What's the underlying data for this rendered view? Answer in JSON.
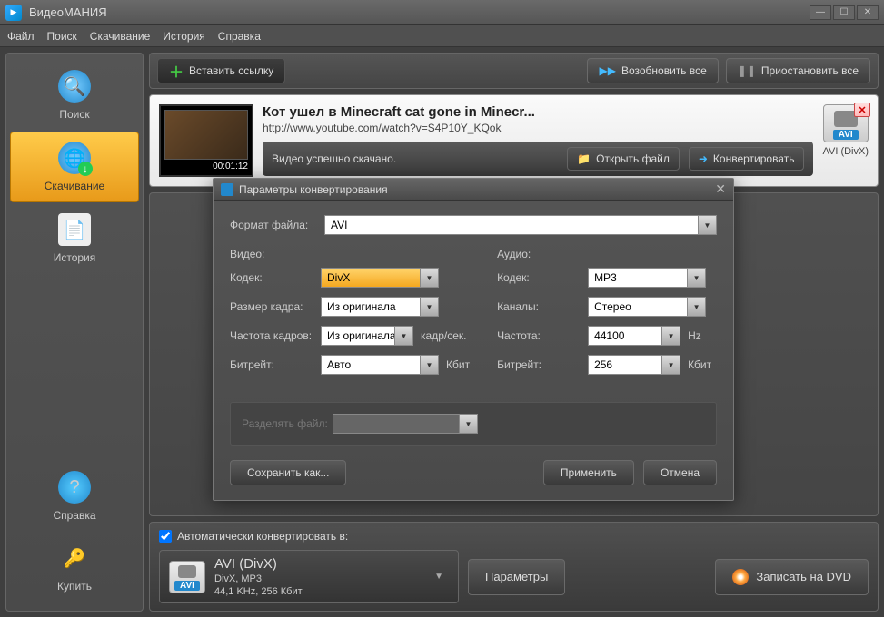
{
  "app": {
    "title": "ВидеоМАНИЯ"
  },
  "menu": {
    "file": "Файл",
    "search": "Поиск",
    "download": "Скачивание",
    "history": "История",
    "help": "Справка"
  },
  "sidebar": {
    "search": "Поиск",
    "download": "Скачивание",
    "history": "История",
    "help": "Справка",
    "buy": "Купить"
  },
  "toolbar": {
    "paste": "Вставить ссылку",
    "resume_all": "Возобновить все",
    "pause_all": "Приостановить все"
  },
  "item": {
    "title": "Кот ушел в Minecraft  cat gone in Minecr...",
    "url": "http://www.youtube.com/watch?v=S4P10Y_KQok",
    "status": "Видео успешно скачано.",
    "open": "Открыть файл",
    "convert": "Конвертировать",
    "time": "00:01:12",
    "format_short": "AVI",
    "format_caption": "AVI (DivX)"
  },
  "modal": {
    "title": "Параметры конвертирования",
    "file_format_label": "Формат файла:",
    "file_format_value": "AVI",
    "video": {
      "heading": "Видео:",
      "codec_label": "Кодек:",
      "codec_value": "DivX",
      "frame_size_label": "Размер кадра:",
      "frame_size_value": "Из оригинала",
      "fps_label": "Частота кадров:",
      "fps_value": "Из оригинала",
      "fps_unit": "кадр/сек.",
      "bitrate_label": "Битрейт:",
      "bitrate_value": "Авто",
      "bitrate_unit": "Кбит"
    },
    "audio": {
      "heading": "Аудио:",
      "codec_label": "Кодек:",
      "codec_value": "MP3",
      "channels_label": "Каналы:",
      "channels_value": "Стерео",
      "freq_label": "Частота:",
      "freq_value": "44100",
      "freq_unit": "Hz",
      "bitrate_label": "Битрейт:",
      "bitrate_value": "256",
      "bitrate_unit": "Кбит"
    },
    "split_label": "Разделять файл:",
    "save_as": "Сохранить как...",
    "apply": "Применить",
    "cancel": "Отмена"
  },
  "bottom": {
    "auto_label": "Автоматически конвертировать в:",
    "format_name": "AVI (DivX)",
    "format_line1": "DivX, MP3",
    "format_line2": "44,1 KHz, 256 Кбит",
    "format_short": "AVI",
    "params": "Параметры",
    "burn": "Записать на DVD"
  }
}
